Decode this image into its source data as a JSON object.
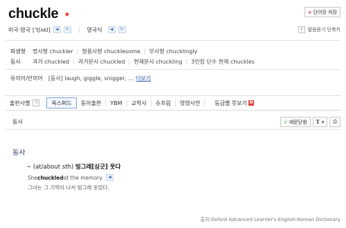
{
  "entry": {
    "word": "chuckle",
    "star": "★",
    "save_button": "단어장 저장",
    "save_plus": "+"
  },
  "pronunciation": {
    "us_label": "미국·영국",
    "ipa": "[ˈtʃʌkl]",
    "uk_label": "영국식",
    "help_label": "발음듣기 단축키",
    "help_q": "?"
  },
  "forms": {
    "row1_head": "파생형",
    "row1": [
      "명사형 chuckler",
      "형용사형 chucklesome",
      "부사형 chucklingly"
    ],
    "row2_head": "동사",
    "row2": [
      "과거 chuckled",
      "과거분사 chuckled",
      "현재분사 chuckling",
      "3인칭 단수 현재 chuckles"
    ]
  },
  "synonyms": {
    "head": "유의어/반의어",
    "text": "[동사] laugh, giggle, snigger, ...",
    "more": "더보기"
  },
  "tabs": {
    "source_label": "출판사별",
    "q": "?",
    "items": [
      "옥스퍼드",
      "동아출판",
      "YBM",
      "교학사",
      "슈프림",
      "영영사전",
      "등급별 뜻보기"
    ],
    "new_badge": "N"
  },
  "toolbar": {
    "pos_label": "동사",
    "examples_button": "예문닫힘",
    "font_button": "T",
    "font_caret": "▾",
    "print_icon": "⎙"
  },
  "sense": {
    "pos": "동사",
    "def_prefix": "~ (at/about sth)",
    "def_ko": "빙그레[싱긋] 웃다",
    "example_pre": "She ",
    "example_word": "chuckled",
    "example_post": " at the memory.",
    "example_ko": "그녀는 그 기억이 나서 빙그레 웃었다."
  },
  "source": "출처:Oxford Advanced Learner's English-Korean Dictionary",
  "colors": {
    "star": "#d9302c",
    "link": "#2454a6",
    "new_badge": "#e8413b"
  }
}
